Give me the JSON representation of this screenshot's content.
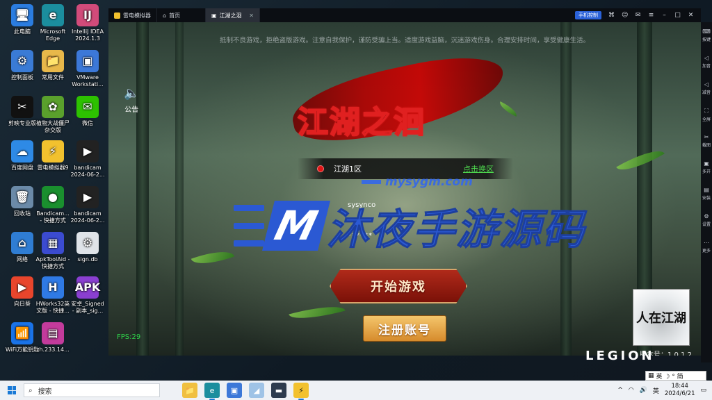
{
  "desktop": {
    "icons": [
      {
        "label": "此电脑",
        "glyph": "🖥",
        "color": "#2b7de0"
      },
      {
        "label": "Microsoft Edge",
        "glyph": "e",
        "color": "#1b8e9e"
      },
      {
        "label": "IntelliJ IDEA 2024.1.3",
        "glyph": "IJ",
        "color": "#d14b7a"
      },
      {
        "label": "控制面板",
        "glyph": "⚙",
        "color": "#3a7bd5"
      },
      {
        "label": "常用文件",
        "glyph": "📁",
        "color": "#e8b84a"
      },
      {
        "label": "VMware Workstati...",
        "glyph": "▣",
        "color": "#3c78d8"
      },
      {
        "label": "剪映专业版",
        "glyph": "✂",
        "color": "#111111"
      },
      {
        "label": "植物大战僵尸杂交版",
        "glyph": "✿",
        "color": "#5aa02c"
      },
      {
        "label": "微信",
        "glyph": "✉",
        "color": "#2dc100"
      },
      {
        "label": "百度网盘",
        "glyph": "☁",
        "color": "#2e8ae6"
      },
      {
        "label": "雷电模拟器9",
        "glyph": "⚡",
        "color": "#f2c12e"
      },
      {
        "label": "bandicam 2024-06-2...",
        "glyph": "▶",
        "color": "#222222"
      },
      {
        "label": "回收站",
        "glyph": "🗑",
        "color": "#6b8aa8"
      },
      {
        "label": "Bandicam... - 快捷方式",
        "glyph": "●",
        "color": "#1a8f2e"
      },
      {
        "label": "bandicam 2024-06-2...",
        "glyph": "▶",
        "color": "#222222"
      },
      {
        "label": "网络",
        "glyph": "⌂",
        "color": "#2f7dd3"
      },
      {
        "label": "ApkToolAid - 快捷方式",
        "glyph": "▦",
        "color": "#3b4bd0"
      },
      {
        "label": "sign.db",
        "glyph": "⚙",
        "color": "#dfe3e8"
      },
      {
        "label": "向日葵",
        "glyph": "▶",
        "color": "#e8452c"
      },
      {
        "label": "HWorks32英文版 - 快捷...",
        "glyph": "H",
        "color": "#2f7ae5"
      },
      {
        "label": "安卓_Signed - 副本_sig...",
        "glyph": "APK",
        "color": "#8a3fd1"
      },
      {
        "label": "WiFi万能钥匙",
        "glyph": "📶",
        "color": "#1a73e8"
      },
      {
        "label": "zh.233.14...",
        "glyph": "▤",
        "color": "#c33b9c"
      }
    ]
  },
  "emulator": {
    "tabs": [
      {
        "label": "雷电模拟器"
      },
      {
        "label": "首页"
      },
      {
        "label": "江湖之洄"
      }
    ],
    "phone_control": "手机控制",
    "sidebar_items": [
      "按键",
      "加音",
      "减音",
      "全屏",
      "截图",
      "多开",
      "安装",
      "设置",
      "更多"
    ],
    "game": {
      "health_notice": "抵制不良游戏，拒绝盗版游戏。注意自我保护，谨防受骗上当。适度游戏益脑，沉迷游戏伤身。合理安排时间，享受健康生活。",
      "announce_label": "公告",
      "logo_title": "江湖之洄",
      "server_name": "江湖1区",
      "switch_server": "点击换区",
      "account_value": "sysynco",
      "password_value": "******",
      "start_button": "开始游戏",
      "register_button": "注册账号",
      "fps": "FPS:29",
      "badge_text": "人在江湖",
      "version": "版本号：1.0.1.2"
    },
    "watermark": {
      "url": "mysygm.com",
      "letter": "M",
      "name": "沐夜手游源码"
    }
  },
  "legion_brand": "LEGION",
  "taskbar": {
    "search_placeholder": "搜索",
    "ime_text": "英 ☽ ° 简",
    "tray_lang": "英",
    "time": "18:44",
    "date": "2024/6/21"
  }
}
